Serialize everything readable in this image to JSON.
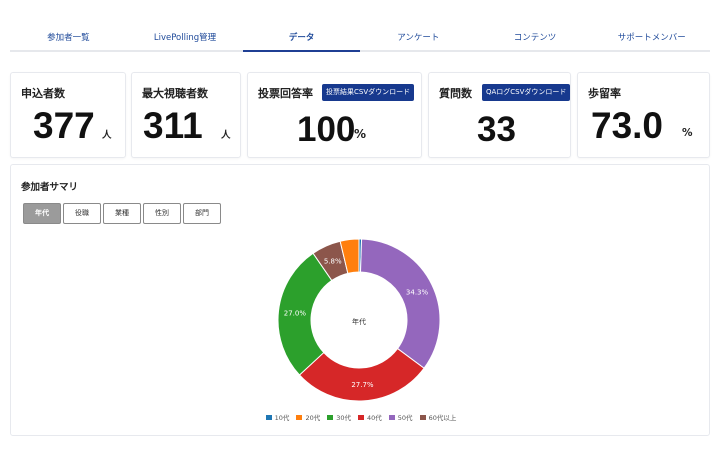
{
  "tabs": [
    {
      "label": "参加者一覧",
      "active": false
    },
    {
      "label": "LivePolling管理",
      "active": false
    },
    {
      "label": "データ",
      "active": true
    },
    {
      "label": "アンケート",
      "active": false
    },
    {
      "label": "コンテンツ",
      "active": false
    },
    {
      "label": "サポートメンバー",
      "active": false
    }
  ],
  "metrics": {
    "applicants": {
      "label": "申込者数",
      "value": "377",
      "unit": "人"
    },
    "max_viewers": {
      "label": "最大視聴者数",
      "value": "311",
      "unit": "人"
    },
    "vote_rate": {
      "label": "投票回答率",
      "value": "100",
      "unit": "%",
      "button": "投票結果CSVダウンロード"
    },
    "questions": {
      "label": "質問数",
      "value": "33",
      "button": "QAログCSVダウンロード"
    },
    "retention": {
      "label": "歩留率",
      "value": "73.0",
      "unit": "%"
    }
  },
  "summary": {
    "title": "参加者サマリ",
    "filters": [
      {
        "label": "年代",
        "active": true
      },
      {
        "label": "役職",
        "active": false
      },
      {
        "label": "業種",
        "active": false
      },
      {
        "label": "性別",
        "active": false
      },
      {
        "label": "部門",
        "active": false
      }
    ]
  },
  "chart_data": {
    "type": "pie",
    "center_label": "年代",
    "categories": [
      "10代",
      "20代",
      "30代",
      "40代",
      "50代",
      "60代以上"
    ],
    "values": [
      0.5,
      3.7,
      27.0,
      27.7,
      34.3,
      5.8
    ],
    "data_labels": [
      "",
      "",
      "27.0%",
      "27.7%",
      "34.3%",
      "5.8%"
    ],
    "colors": [
      "#1f77b4",
      "#ff7f0e",
      "#2ca02c",
      "#d62728",
      "#9467bd",
      "#8c564b"
    ],
    "legend_position": "bottom"
  }
}
